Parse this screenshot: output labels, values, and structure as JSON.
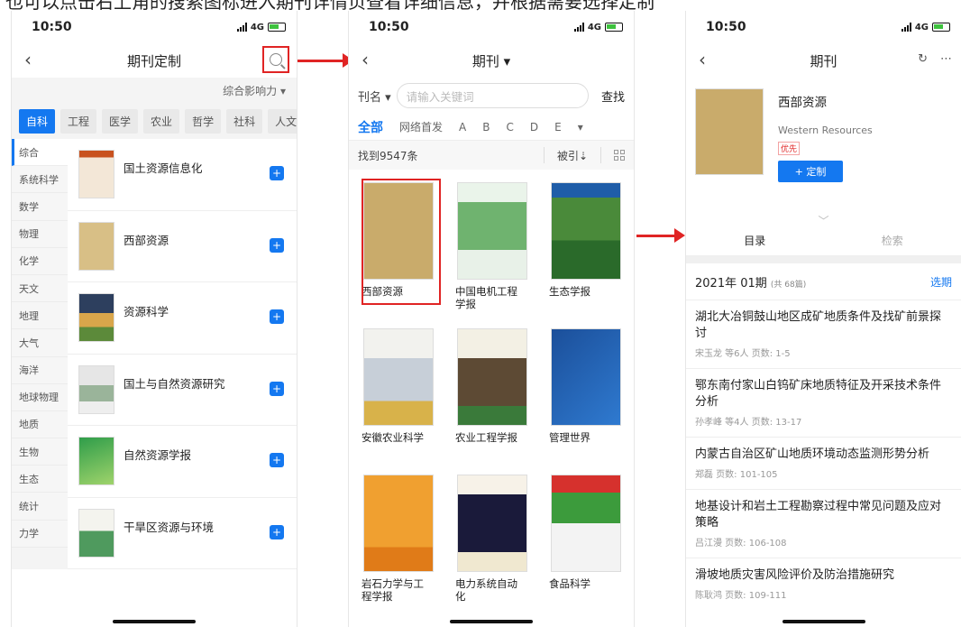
{
  "caption": "也可以点击右上角的搜索图标进入期刊详情页查看详细信息，并根据需要选择定制",
  "status": {
    "time": "10:50",
    "network": "4G"
  },
  "screen1": {
    "title": "期刊定制",
    "sort_label": "综合影响力 ▾",
    "subjects": [
      "自科",
      "工程",
      "医学",
      "农业",
      "哲学",
      "社科",
      "人文"
    ],
    "categories": [
      "综合",
      "系统科学",
      "数学",
      "物理",
      "化学",
      "天文",
      "地理",
      "大气",
      "海洋",
      "地球物理",
      "地质",
      "生物",
      "生态",
      "统计",
      "力学"
    ],
    "journals": [
      "国土资源信息化",
      "西部资源",
      "资源科学",
      "国土与自然资源研究",
      "自然资源学报",
      "干旱区资源与环境"
    ],
    "add": "+"
  },
  "screen2": {
    "title": "期刊 ▾",
    "field": "刊名 ▾",
    "placeholder": "请输入关键词",
    "search": "查找",
    "letters": [
      "全部",
      "网络首发",
      "A",
      "B",
      "C",
      "D",
      "E",
      "▾"
    ],
    "count": "找到9547条",
    "sort": "被引⇣",
    "journals": [
      "西部资源",
      "中国电机工程学报",
      "生态学报",
      "安徽农业科学",
      "农业工程学报",
      "管理世界",
      "岩石力学与工程学报",
      "电力系统自动化",
      "食品科学"
    ]
  },
  "screen3": {
    "title": "期刊",
    "name": "西部资源",
    "english": "Western Resources",
    "badge": "优先",
    "subscribe": "+ 定制",
    "tab_catalog": "目录",
    "tab_search": "检索",
    "issue": "2021年 01期",
    "issue_count": "(共 68篇)",
    "pick": "选期",
    "articles": [
      {
        "title": "湖北大冶铜鼓山地区成矿地质条件及找矿前景探讨",
        "meta": "宋玉龙 等6人   页数: 1-5"
      },
      {
        "title": "鄂东南付家山白钨矿床地质特征及开采技术条件分析",
        "meta": "孙孝峰 等4人   页数: 13-17"
      },
      {
        "title": "内蒙古自治区矿山地质环境动态监测形势分析",
        "meta": "郑磊   页数: 101-105"
      },
      {
        "title": "地基设计和岩土工程勘察过程中常见问题及应对策略",
        "meta": "吕江漫   页数: 106-108"
      },
      {
        "title": "滑坡地质灾害风险评价及防治措施研究",
        "meta": "陈耿鸿   页数: 109-111"
      }
    ]
  },
  "colors": {
    "accent": "#1478f0",
    "highlight": "#e02424"
  }
}
